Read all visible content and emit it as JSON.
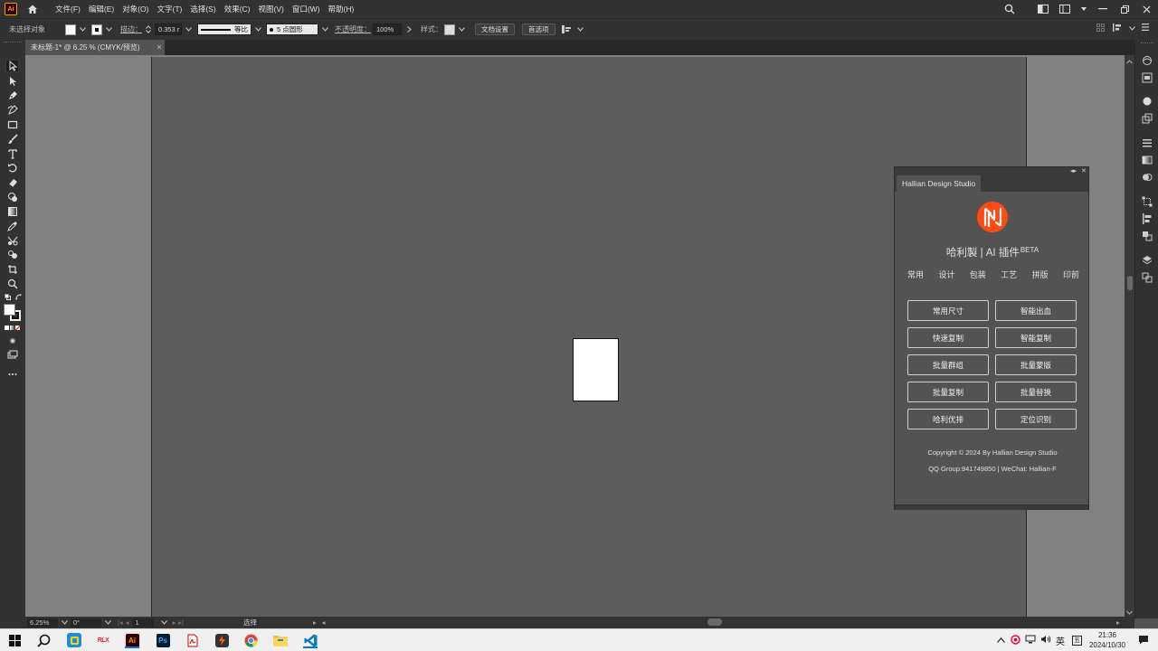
{
  "menubar": {
    "app_badge": "Ai",
    "menus": [
      "文件(F)",
      "编辑(E)",
      "对象(O)",
      "文字(T)",
      "选择(S)",
      "效果(C)",
      "视图(V)",
      "窗口(W)",
      "帮助(H)"
    ]
  },
  "controlbar": {
    "no_selection": "未选择对象",
    "stroke_label": "描边：",
    "stroke_value": "0.353 r",
    "stroke_style": "等比",
    "brush": "5 点圆形",
    "opacity_label": "不透明度：",
    "opacity_value": "100%",
    "style_label": "样式：",
    "doc_setup": "文档设置",
    "preferences": "首选项"
  },
  "document_tab": {
    "title": "未标题-1* @ 6.25 % (CMYK/预览)",
    "close": "×"
  },
  "statusbar": {
    "zoom": "6.25%",
    "rotation": "0°",
    "artboard_num": "1",
    "tool_name": "选择"
  },
  "plugin_panel": {
    "tab": "Hallian Design Studio",
    "title": "哈利製 | AI 插件",
    "beta": "BETA",
    "categories": [
      "常用",
      "设计",
      "包装",
      "工艺",
      "拼版",
      "印前"
    ],
    "buttons": [
      "常用尺寸",
      "智能出血",
      "快速复制",
      "智能复制",
      "批量群组",
      "批量蒙版",
      "批量复制",
      "批量替换",
      "哈利优排",
      "定位识别"
    ],
    "copyright": "Copyright © 2024 By Hallian Design Studio",
    "contact": "QQ Group:941749850 | WeChat: Hallian-F",
    "brand_color": "#ff4a12"
  },
  "taskbar": {
    "time": "21:36",
    "date": "2024/10/30",
    "ime": "英",
    "apps": [
      "start",
      "search",
      "qt-app",
      "rtx-app",
      "illustrator",
      "photoshop",
      "acrobat",
      "plugin-app",
      "chrome",
      "file-explorer",
      "vscode"
    ]
  },
  "colors": {
    "ui_dark": "#323232",
    "canvas": "#5d5d5d",
    "pasteboard": "#818181",
    "accent_ai": "#ff9a00"
  }
}
